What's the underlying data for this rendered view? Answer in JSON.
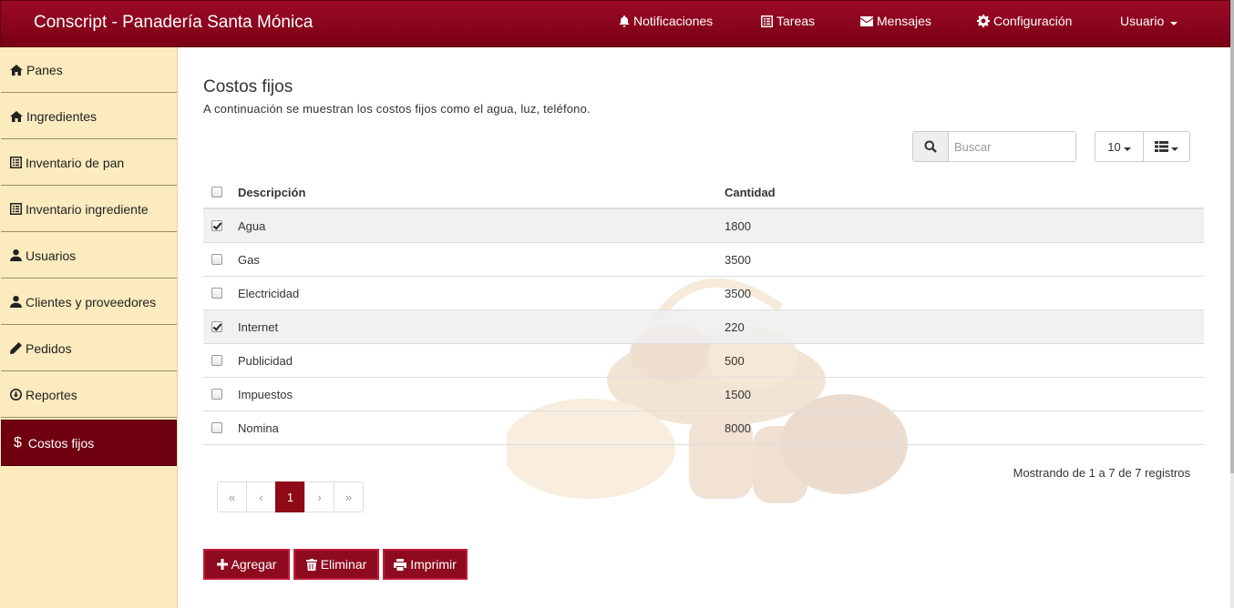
{
  "navbar": {
    "brand": "Conscript - Panadería Santa Mónica",
    "items": [
      {
        "label": "Notificaciones",
        "icon": "bell-icon"
      },
      {
        "label": "Tareas",
        "icon": "list-icon"
      },
      {
        "label": "Mensajes",
        "icon": "envelope-icon"
      },
      {
        "label": "Configuración",
        "icon": "gear-icon"
      },
      {
        "label": "Usuario",
        "icon": "caret-down-icon"
      }
    ]
  },
  "sidebar": {
    "items": [
      {
        "label": "Panes",
        "icon": "home-icon"
      },
      {
        "label": "Ingredientes",
        "icon": "home-icon"
      },
      {
        "label": "Inventario de pan",
        "icon": "list-alt-icon"
      },
      {
        "label": "Inventario ingrediente",
        "icon": "list-alt-icon"
      },
      {
        "label": "Usuarios",
        "icon": "user-icon"
      },
      {
        "label": "Clientes y proveedores",
        "icon": "user-icon"
      },
      {
        "label": "Pedidos",
        "icon": "pencil-icon"
      },
      {
        "label": "Reportes",
        "icon": "download-circle-icon"
      },
      {
        "label": "Costos fijos",
        "icon": "dollar-icon",
        "symbol": "$",
        "active": true
      }
    ]
  },
  "page": {
    "title": "Costos fijos",
    "subtitle": "A continuación se muestran los costos fijos como el agua, luz, teléfono."
  },
  "toolbar": {
    "search_placeholder": "Buscar",
    "page_size": "10"
  },
  "table": {
    "headers": {
      "descripcion": "Descripción",
      "cantidad": "Cantidad"
    },
    "rows": [
      {
        "descripcion": "Agua",
        "cantidad": "1800",
        "checked": true
      },
      {
        "descripcion": "Gas",
        "cantidad": "3500",
        "checked": false
      },
      {
        "descripcion": "Electricidad",
        "cantidad": "3500",
        "checked": false
      },
      {
        "descripcion": "Internet",
        "cantidad": "220",
        "checked": true
      },
      {
        "descripcion": "Publicidad",
        "cantidad": "500",
        "checked": false
      },
      {
        "descripcion": "Impuestos",
        "cantidad": "1500",
        "checked": false
      },
      {
        "descripcion": "Nomina",
        "cantidad": "8000",
        "checked": false
      }
    ]
  },
  "pagination": {
    "info": "Mostrando de 1 a 7 de 7 registros",
    "first": "«",
    "prev": "‹",
    "current": "1",
    "next": "›",
    "last": "»"
  },
  "actions": {
    "add": "Agregar",
    "delete": "Eliminar",
    "print": "Imprimir"
  },
  "colors": {
    "brand": "#8e0a1e",
    "sidebar_bg": "#fbebbe",
    "sidebar_active": "#6f0010"
  }
}
